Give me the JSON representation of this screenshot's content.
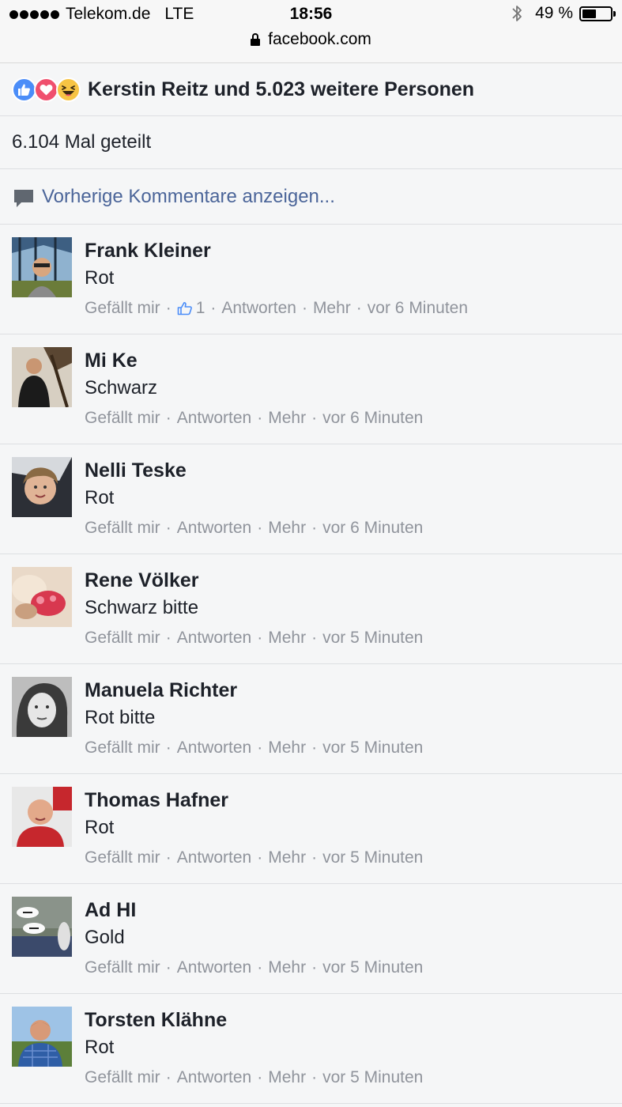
{
  "status_bar": {
    "carrier": "Telekom.de",
    "network": "LTE",
    "time": "18:56",
    "battery": "49 %",
    "battery_level": 0.49,
    "url": "facebook.com"
  },
  "reactions": {
    "text": "Kerstin Reitz und 5.023 weitere Personen",
    "icons": [
      "like-icon",
      "love-icon",
      "haha-icon"
    ]
  },
  "shares": {
    "text": "6.104 Mal geteilt"
  },
  "previous_comments": {
    "label": "Vorherige Kommentare anzeigen..."
  },
  "comment_actions": {
    "like": "Gefällt mir",
    "reply": "Antworten",
    "more": "Mehr",
    "sep": "·"
  },
  "comments": [
    {
      "name": "Frank Kleiner",
      "text": "Rot",
      "time": "vor 6 Minuten",
      "likes": "1"
    },
    {
      "name": "Mi Ke",
      "text": "Schwarz",
      "time": "vor 6 Minuten"
    },
    {
      "name": "Nelli Teske",
      "text": "Rot",
      "time": "vor 6 Minuten"
    },
    {
      "name": "Rene Völker",
      "text": "Schwarz bitte",
      "time": "vor 5 Minuten"
    },
    {
      "name": "Manuela Richter",
      "text": "Rot bitte",
      "time": "vor 5 Minuten"
    },
    {
      "name": "Thomas Hafner",
      "text": "Rot",
      "time": "vor 5 Minuten"
    },
    {
      "name": "Ad HI",
      "text": "Gold",
      "time": "vor 5 Minuten"
    },
    {
      "name": "Torsten Klähne",
      "text": "Rot",
      "time": "vor 5 Minuten"
    }
  ],
  "colors": {
    "link": "#4b6599",
    "meta": "#90949c",
    "divider": "#dddfe2",
    "like": "#4b8df8",
    "love": "#f0506e",
    "haha": "#f7c444"
  }
}
